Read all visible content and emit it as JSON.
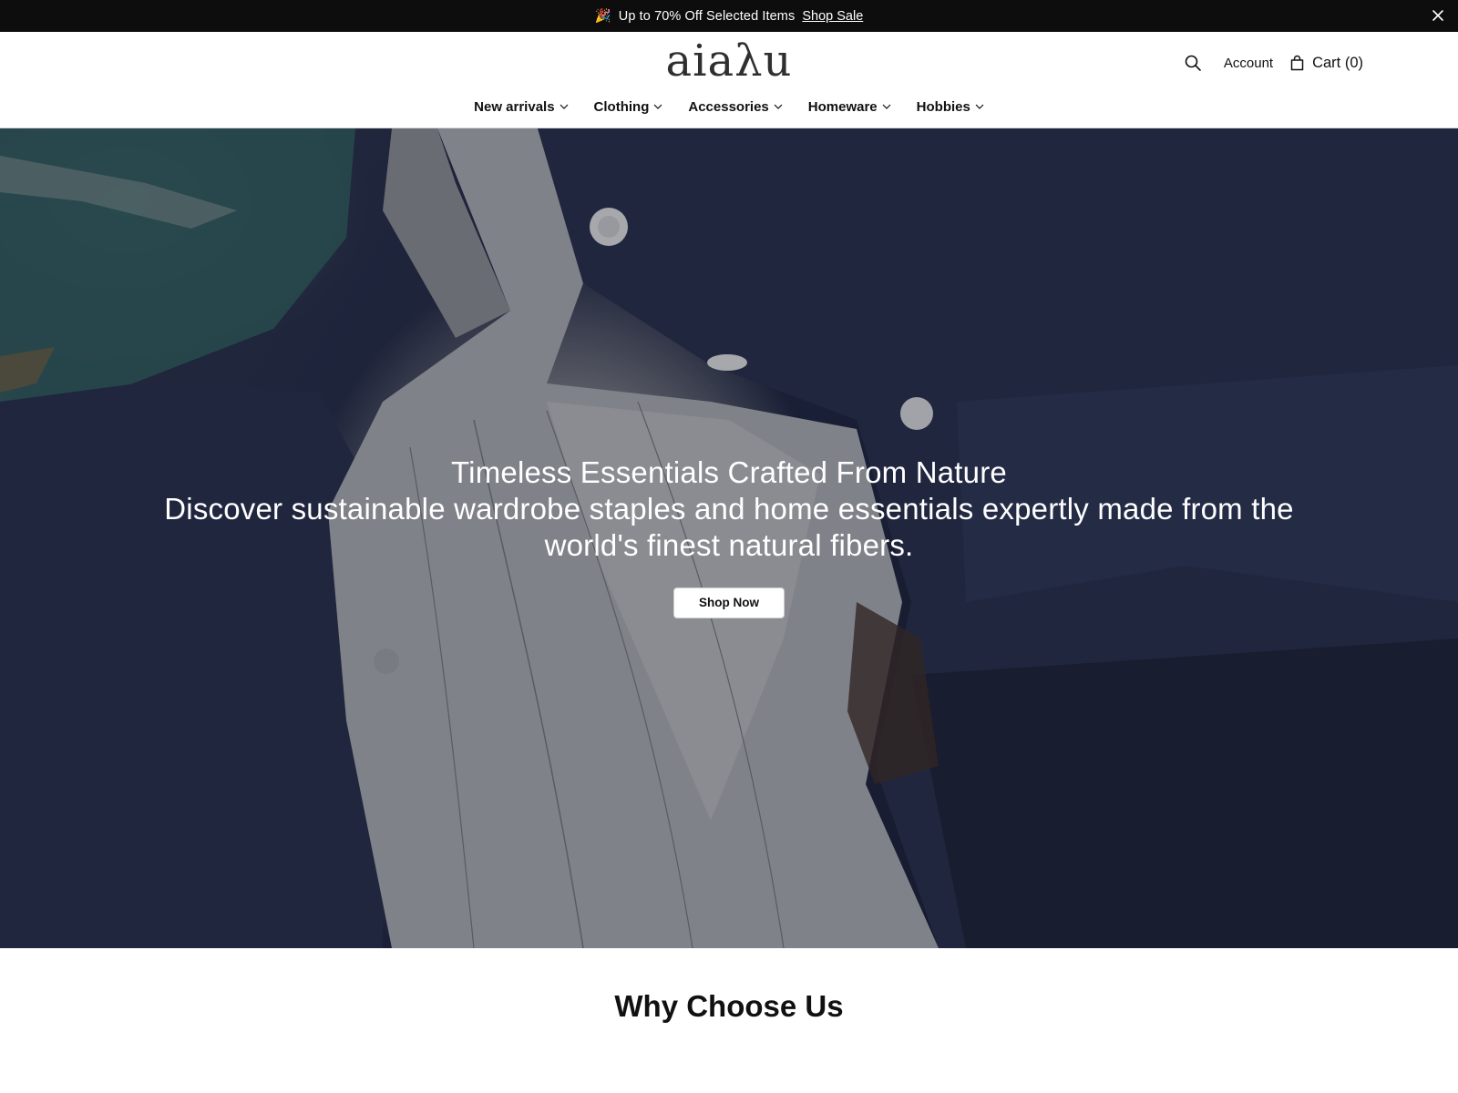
{
  "announcement": {
    "emoji": "🎉",
    "message": "Up to 70% Off Selected Items",
    "link": "Shop Sale"
  },
  "header": {
    "logo": "aiaλu",
    "account": "Account",
    "cart": "Cart (0)"
  },
  "nav": {
    "items": [
      {
        "label": "New arrivals"
      },
      {
        "label": "Clothing"
      },
      {
        "label": "Accessories"
      },
      {
        "label": "Homeware"
      },
      {
        "label": "Hobbies"
      }
    ]
  },
  "hero": {
    "title": "Timeless Essentials Crafted From Nature",
    "subtitle": "Discover sustainable wardrobe staples and home essentials expertly made from the world's finest natural fibers.",
    "button": "Shop Now"
  },
  "sections": {
    "why_title": "Why Choose Us"
  },
  "colors": {
    "announcement_bg": "#0d0d0d",
    "hero_navy": "#1f2640",
    "button_bg": "#ffffff"
  },
  "icons": {
    "close": "close-icon",
    "search": "search-icon",
    "cart": "shopping-bag-icon",
    "chevron": "chevron-down-icon"
  }
}
